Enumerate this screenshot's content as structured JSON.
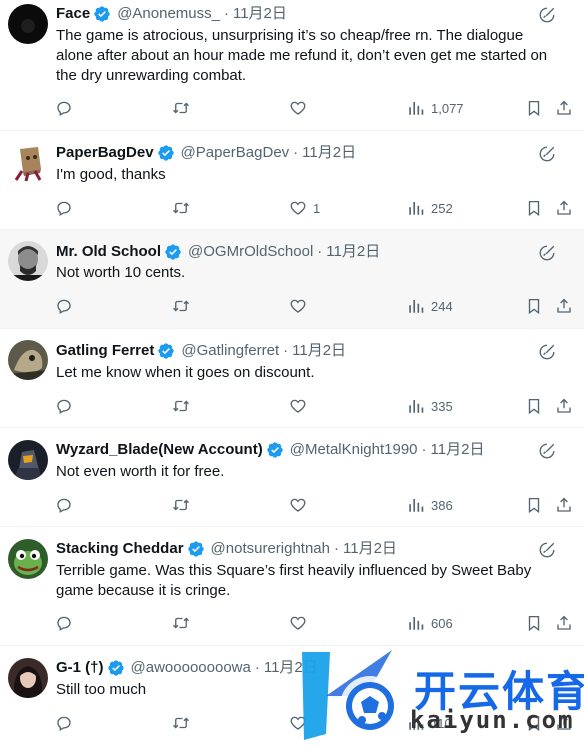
{
  "tweets": [
    {
      "name": "Face",
      "handle": "@Anonemuss_",
      "date": "11月2日",
      "text": "The game is atrocious, unsurprising it’s so cheap/free rn. The dialogue alone after about an hour made me refund it, don’t even get me started on the dry unrewarding combat.",
      "likes": "",
      "views": "1,077"
    },
    {
      "name": "PaperBagDev",
      "handle": "@PaperBagDev",
      "date": "11月2日",
      "text": "I'm good, thanks",
      "likes": "1",
      "views": "252"
    },
    {
      "name": "Mr. Old School",
      "handle": "@OGMrOldSchool",
      "date": "11月2日",
      "text": "Not worth 10 cents.",
      "likes": "",
      "views": "244"
    },
    {
      "name": "Gatling Ferret",
      "handle": "@Gatlingferret",
      "date": "11月2日",
      "text": "Let me know when it goes on discount.",
      "likes": "",
      "views": "335"
    },
    {
      "name": "Wyzard_Blade(New Account)",
      "handle": "@MetalKnight1990",
      "date": "11月2日",
      "text": "Not even worth it for free.",
      "likes": "",
      "views": "386"
    },
    {
      "name": "Stacking Cheddar",
      "handle": "@notsurerightnah",
      "date": "11月2日",
      "text": "Terrible game.  Was this Square’s first heavily influenced by Sweet Baby game because it is cringe.",
      "likes": "",
      "views": "606"
    },
    {
      "name": "G-1 (†)",
      "handle": "@awoooooooowa",
      "date": "11月2日",
      "text": "Still too much",
      "likes": "",
      "views": "110"
    }
  ],
  "separator": "·",
  "watermark": {
    "brand_cn": "开云体育",
    "brand_en": "kaiyun.com"
  },
  "colors": {
    "text": "#0f1419",
    "secondary": "#536471",
    "verified": "#1d9bf0",
    "divider": "#eff3f4",
    "highlight_row": "#f7f7f7",
    "watermark_blue": "#1568e8"
  },
  "icons": {
    "verified": "verified-badge-icon",
    "grok": "grok-icon",
    "reply": "reply-icon",
    "retweet": "retweet-icon",
    "like": "heart-icon",
    "views": "views-icon",
    "bookmark": "bookmark-icon",
    "share": "share-icon"
  }
}
